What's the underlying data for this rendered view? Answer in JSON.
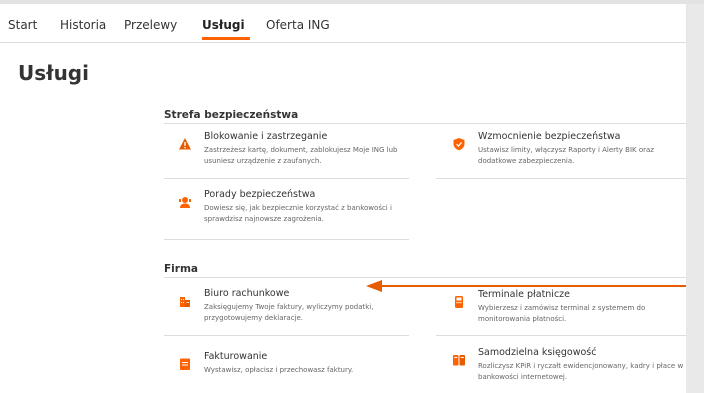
{
  "nav": {
    "tabs": [
      "Start",
      "Historia",
      "Przelewy",
      "Usługi",
      "Oferta ING"
    ]
  },
  "page_title": "Usługi",
  "sections": {
    "security": {
      "title": "Strefa bezpieczeństwa",
      "items": [
        {
          "title": "Blokowanie i zastrzeganie",
          "desc": "Zastrzeżesz kartę, dokument, zablokujesz Moje ING lub usuniesz urządzenie z zaufanych.",
          "icon": "warning-icon"
        },
        {
          "title": "Wzmocnienie bezpieczeństwa",
          "desc": "Ustawisz limity, włączysz Raporty i Alerty BIK oraz dodatkowe zabezpieczenia.",
          "icon": "shield-icon"
        },
        {
          "title": "Porady bezpieczeństwa",
          "desc": "Dowiesz się, jak bezpiecznie korzystać z bankowości i sprawdzisz najnowsze zagrożenia.",
          "icon": "advisor-icon"
        }
      ]
    },
    "company": {
      "title": "Firma",
      "items": [
        {
          "title": "Biuro rachunkowe",
          "desc": "Zaksięgujemy Twoje faktury, wyliczymy podatki, przygotowujemy deklaracje.",
          "icon": "office-building-icon"
        },
        {
          "title": "Terminale płatnicze",
          "desc": "Wybierzesz i zamówisz terminal z systemem do monitorowania płatności.",
          "icon": "payment-terminal-icon"
        },
        {
          "title": "Fakturowanie",
          "desc": "Wystawisz, opłacisz i przechowasz faktury.",
          "icon": "invoice-icon"
        },
        {
          "title": "Samodzielna księgowość",
          "desc": "Rozliczysz KPiR i ryczałt ewidencjonowany, kadry i płace w bankowości internetowej.",
          "icon": "accounting-icon"
        }
      ]
    }
  },
  "colors": {
    "accent": "#ff6200"
  }
}
